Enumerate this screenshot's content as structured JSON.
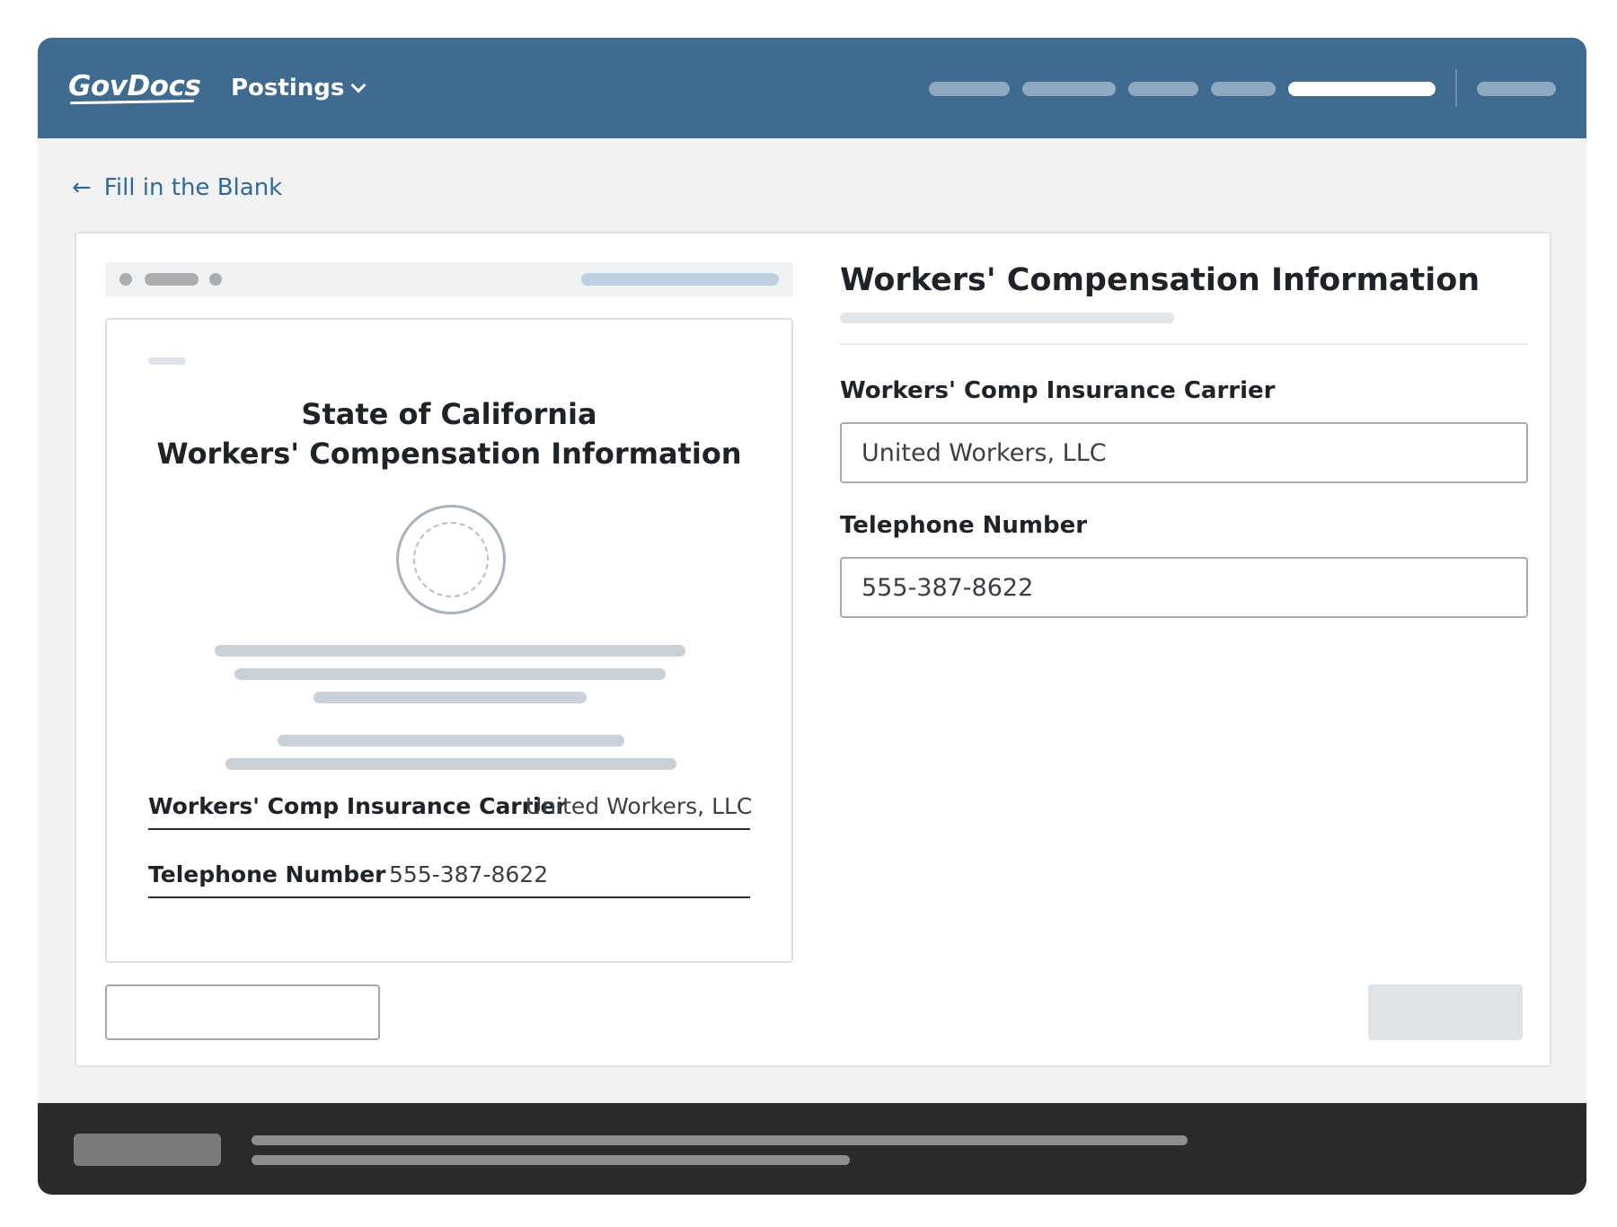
{
  "header": {
    "logo_text": "GovDocs",
    "menu_label": "Postings",
    "brand_color": "#3e6b8f"
  },
  "breadcrumb": {
    "arrow": "←",
    "label": "Fill in the Blank"
  },
  "document_preview": {
    "title_line_1": "State of California",
    "title_line_2": "Workers' Compensation Information",
    "fields": [
      {
        "label": "Workers' Comp Insurance Carrier",
        "value": "United Workers, LLC"
      },
      {
        "label": "Telephone Number",
        "value": "555-387-8622"
      }
    ]
  },
  "form": {
    "title": "Workers' Compensation Information",
    "fields": [
      {
        "label": "Workers' Comp Insurance Carrier",
        "value": "United Workers, LLC"
      },
      {
        "label": "Telephone Number",
        "value": "555-387-8622"
      }
    ]
  }
}
